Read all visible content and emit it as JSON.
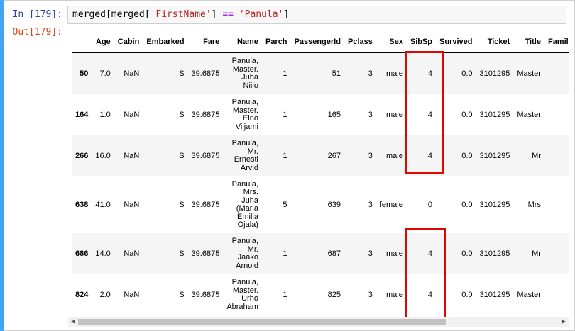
{
  "cell": {
    "in_prompt": "In [179]:",
    "out_prompt": "Out[179]:",
    "code": {
      "p1": "merged[merged[",
      "s1": "'FirstName'",
      "p2": "] ",
      "op": "==",
      "p3": " ",
      "s2": "'Panula'",
      "p4": "]"
    }
  },
  "table": {
    "columns": [
      "",
      "Age",
      "Cabin",
      "Embarked",
      "Fare",
      "Name",
      "Parch",
      "PassengerId",
      "Pclass",
      "Sex",
      "SibSp",
      "Survived",
      "Ticket",
      "Title",
      "Family"
    ],
    "rows": [
      {
        "idx": "50",
        "age": "7.0",
        "cabin": "NaN",
        "emb": "S",
        "fare": "39.6875",
        "name": "Panula, Master. Juha Niilo",
        "parch": "1",
        "pid": "51",
        "pclass": "3",
        "sex": "male",
        "sibsp": "4",
        "surv": "0.0",
        "ticket": "3101295",
        "title": "Master"
      },
      {
        "idx": "164",
        "age": "1.0",
        "cabin": "NaN",
        "emb": "S",
        "fare": "39.6875",
        "name": "Panula, Master. Eino Viljami",
        "parch": "1",
        "pid": "165",
        "pclass": "3",
        "sex": "male",
        "sibsp": "4",
        "surv": "0.0",
        "ticket": "3101295",
        "title": "Master"
      },
      {
        "idx": "266",
        "age": "16.0",
        "cabin": "NaN",
        "emb": "S",
        "fare": "39.6875",
        "name": "Panula, Mr. Ernesti Arvid",
        "parch": "1",
        "pid": "267",
        "pclass": "3",
        "sex": "male",
        "sibsp": "4",
        "surv": "0.0",
        "ticket": "3101295",
        "title": "Mr"
      },
      {
        "idx": "638",
        "age": "41.0",
        "cabin": "NaN",
        "emb": "S",
        "fare": "39.6875",
        "name": "Panula, Mrs. Juha (Maria Emilia Ojala)",
        "parch": "5",
        "pid": "639",
        "pclass": "3",
        "sex": "female",
        "sibsp": "0",
        "surv": "0.0",
        "ticket": "3101295",
        "title": "Mrs"
      },
      {
        "idx": "686",
        "age": "14.0",
        "cabin": "NaN",
        "emb": "S",
        "fare": "39.6875",
        "name": "Panula, Mr. Jaako Arnold",
        "parch": "1",
        "pid": "687",
        "pclass": "3",
        "sex": "male",
        "sibsp": "4",
        "surv": "0.0",
        "ticket": "3101295",
        "title": "Mr"
      },
      {
        "idx": "824",
        "age": "2.0",
        "cabin": "NaN",
        "emb": "S",
        "fare": "39.6875",
        "name": "Panula, Master. Urho Abraham",
        "parch": "1",
        "pid": "825",
        "pclass": "3",
        "sex": "male",
        "sibsp": "4",
        "surv": "0.0",
        "ticket": "3101295",
        "title": "Master"
      }
    ]
  },
  "scrollbar": {
    "left_icon": "triangle-left-icon",
    "right_icon": "triangle-right-icon",
    "left_glyph": "◀",
    "right_glyph": "▶"
  },
  "highlight_color": "#e10600",
  "code_string_color": "#ba2121",
  "code_operator_color": "#aa22ff"
}
